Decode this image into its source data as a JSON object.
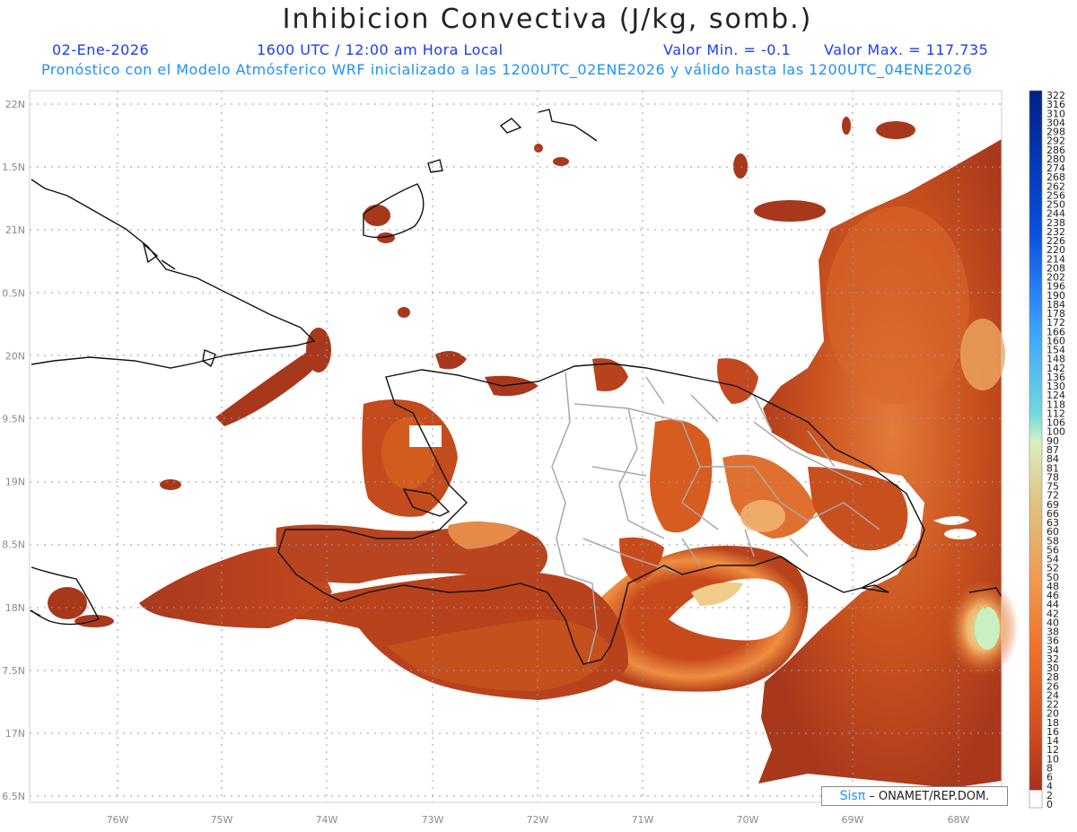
{
  "title": "Inhibicion Convectiva (J/kg, somb.)",
  "date": "02-Ene-2026",
  "time": "1600 UTC / 12:00 am Hora Local",
  "valmin": "Valor Min. = -0.1",
  "valmax": "Valor Max. = 117.735",
  "forecast": "Pronóstico con el Modelo Atmósferico WRF inicializado a las 1200UTC_02ENE2026 y válido hasta las  1200UTC_04ENE2026",
  "credit": {
    "sis": "Sisπ",
    "org": "– ONAMET/REP.DOM."
  },
  "lon_labels": [
    "76W",
    "75W",
    "74W",
    "73W",
    "72W",
    "71W",
    "70W",
    "69W",
    "68W"
  ],
  "lat_labels": [
    "22N",
    "1.5N",
    "21N",
    "0.5N",
    "20N",
    "9.5N",
    "19N",
    "8.5N",
    "18N",
    "7.5N",
    "17N",
    "6.5N"
  ],
  "colorbar_labels": [
    "322",
    "316",
    "310",
    "304",
    "298",
    "292",
    "286",
    "280",
    "274",
    "268",
    "262",
    "256",
    "250",
    "244",
    "238",
    "232",
    "226",
    "220",
    "214",
    "208",
    "202",
    "196",
    "190",
    "184",
    "178",
    "172",
    "166",
    "160",
    "154",
    "148",
    "142",
    "136",
    "130",
    "124",
    "118",
    "112",
    "106",
    "100",
    "90",
    "87",
    "84",
    "81",
    "78",
    "75",
    "72",
    "69",
    "66",
    "63",
    "60",
    "58",
    "56",
    "54",
    "52",
    "50",
    "48",
    "46",
    "44",
    "42",
    "40",
    "38",
    "36",
    "34",
    "32",
    "30",
    "28",
    "26",
    "24",
    "22",
    "20",
    "18",
    "16",
    "14",
    "12",
    "10",
    "8",
    "6",
    "4",
    "2",
    "0"
  ],
  "colors": {
    "shade_low": "#a83a1e",
    "shade_mid": "#d8561c",
    "shade_high": "#f0a060",
    "shade_peak": "#cfe8b0",
    "coast": "#111111",
    "border": "#a8a8a8",
    "grid": "#9a9a9a"
  }
}
